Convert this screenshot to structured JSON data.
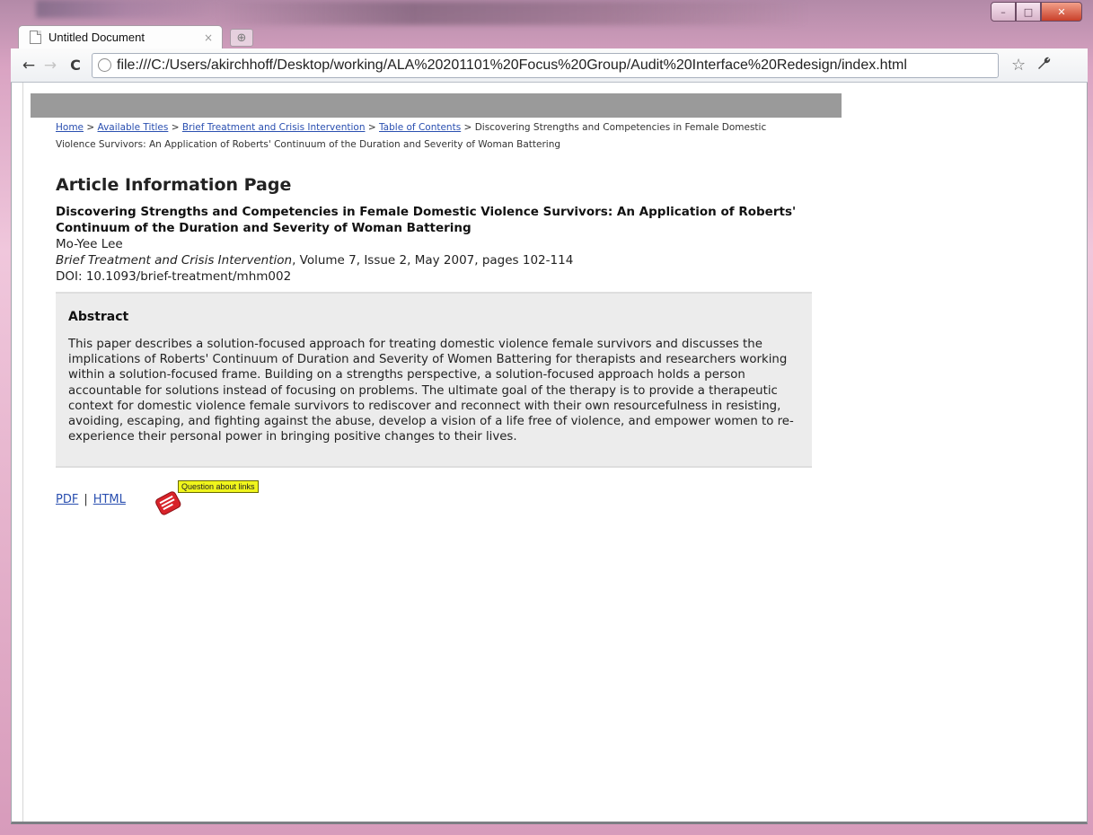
{
  "window": {
    "controls": {
      "minimize": "–",
      "maximize": "□",
      "close": "✕"
    }
  },
  "tab": {
    "title": "Untitled Document",
    "close": "×",
    "new_tab": "⊕"
  },
  "toolbar": {
    "back": "←",
    "forward": "→",
    "reload": "C",
    "url": "file:///C:/Users/akirchhoff/Desktop/working/ALA%20201101%20Focus%20Group/Audit%20Interface%20Redesign/index.html",
    "star": "☆",
    "wrench": "🔧"
  },
  "breadcrumb": {
    "items": [
      {
        "label": "Home"
      },
      {
        "label": "Available Titles"
      },
      {
        "label": "Brief Treatment and Crisis Intervention"
      },
      {
        "label": "Table of Contents"
      }
    ],
    "separator": ">",
    "current": "Discovering Strengths and Competencies in Female Domestic Violence Survivors: An Application of Roberts' Continuum of the Duration and Severity of Woman Battering"
  },
  "page_title": "Article Information Page",
  "article": {
    "title": "Discovering Strengths and Competencies in Female Domestic Violence Survivors: An Application of Roberts' Continuum of the Duration and Severity of Woman Battering",
    "author": "Mo-Yee Lee",
    "journal": "Brief Treatment and Crisis Intervention",
    "citation_rest": ", Volume 7, Issue 2, May 2007, pages 102-114",
    "doi": "DOI: 10.1093/brief-treatment/mhm002"
  },
  "abstract": {
    "heading": "Abstract",
    "text": "This paper describes a solution-focused approach for treating domestic violence female survivors and discusses the implications of Roberts' Continuum of Duration and Severity of Women Battering for therapists and researchers working within a solution-focused frame. Building on a strengths perspective, a solution-focused approach holds a person accountable for solutions instead of focusing on problems. The ultimate goal of the therapy is to provide a therapeutic context for domestic violence female survivors to rediscover and reconnect with their own resourcefulness in resisting, avoiding, escaping, and fighting against the abuse, develop a vision of a life free of violence, and empower women to re-experience their personal power in bringing positive changes to their lives."
  },
  "links": {
    "pdf": "PDF",
    "separator": "|",
    "html": "HTML"
  },
  "annotation": {
    "icon": "note-icon",
    "tooltip": "Question about links"
  },
  "colors": {
    "link": "#2a4fb0",
    "tooltip_bg": "#f0f51c",
    "note_red": "#d8232a"
  }
}
